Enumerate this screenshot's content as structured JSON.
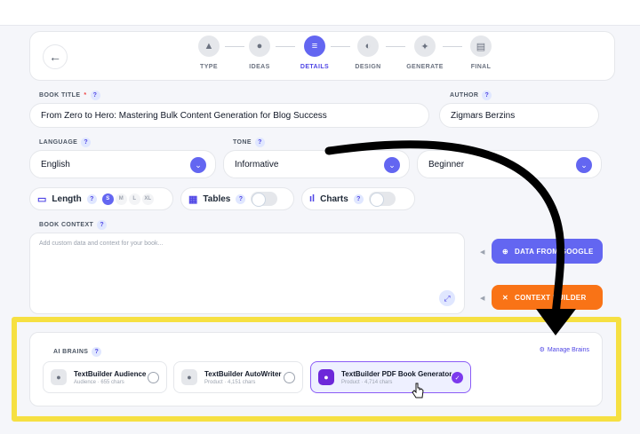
{
  "stepper": {
    "back_icon": "arrow-left-icon",
    "steps": [
      {
        "label": "TYPE",
        "icon": "shapes-icon"
      },
      {
        "label": "IDEAS",
        "icon": "lightbulb-icon"
      },
      {
        "label": "DETAILS",
        "icon": "sliders-icon",
        "active": true
      },
      {
        "label": "DESIGN",
        "icon": "palette-icon"
      },
      {
        "label": "GENERATE",
        "icon": "sparkles-icon"
      },
      {
        "label": "FINAL",
        "icon": "book-icon"
      }
    ]
  },
  "form": {
    "book_title_label": "BOOK TITLE",
    "book_title_required": "*",
    "book_title_value": "From Zero to Hero: Mastering Bulk Content Generation for Blog Success",
    "author_label": "AUTHOR",
    "author_value": "Zigmars Berzins",
    "language_label": "LANGUAGE",
    "language_value": "English",
    "tone_label": "TONE",
    "tone_value": "Informative",
    "level_value": "Beginner",
    "help_glyph": "?"
  },
  "options": {
    "length_label": "Length",
    "sizes": [
      "S",
      "M",
      "L",
      "XL"
    ],
    "selected_size": "S",
    "tables_label": "Tables",
    "charts_label": "Charts"
  },
  "context": {
    "label": "BOOK CONTEXT",
    "placeholder": "Add custom data and context for your book..."
  },
  "actions": {
    "google_label": "DATA FROM GOOGLE",
    "builder_label": "CONTEXT BUILDER",
    "google_color": "#6366f1",
    "builder_color": "#f97316"
  },
  "brains": {
    "label": "AI BRAINS",
    "manage_label": "Manage Brains",
    "items": [
      {
        "name": "TextBuilder Audience",
        "meta": "Audience · 655 chars",
        "selected": false
      },
      {
        "name": "TextBuilder AutoWriter",
        "meta": "Product · 4,151 chars",
        "selected": false
      },
      {
        "name": "TextBuilder PDF Book Generator",
        "meta": "Product · 4,714 chars",
        "selected": true
      }
    ]
  },
  "colors": {
    "accent": "#6366f1",
    "highlight": "#f6e042",
    "annotation_arrow": "#000000"
  }
}
